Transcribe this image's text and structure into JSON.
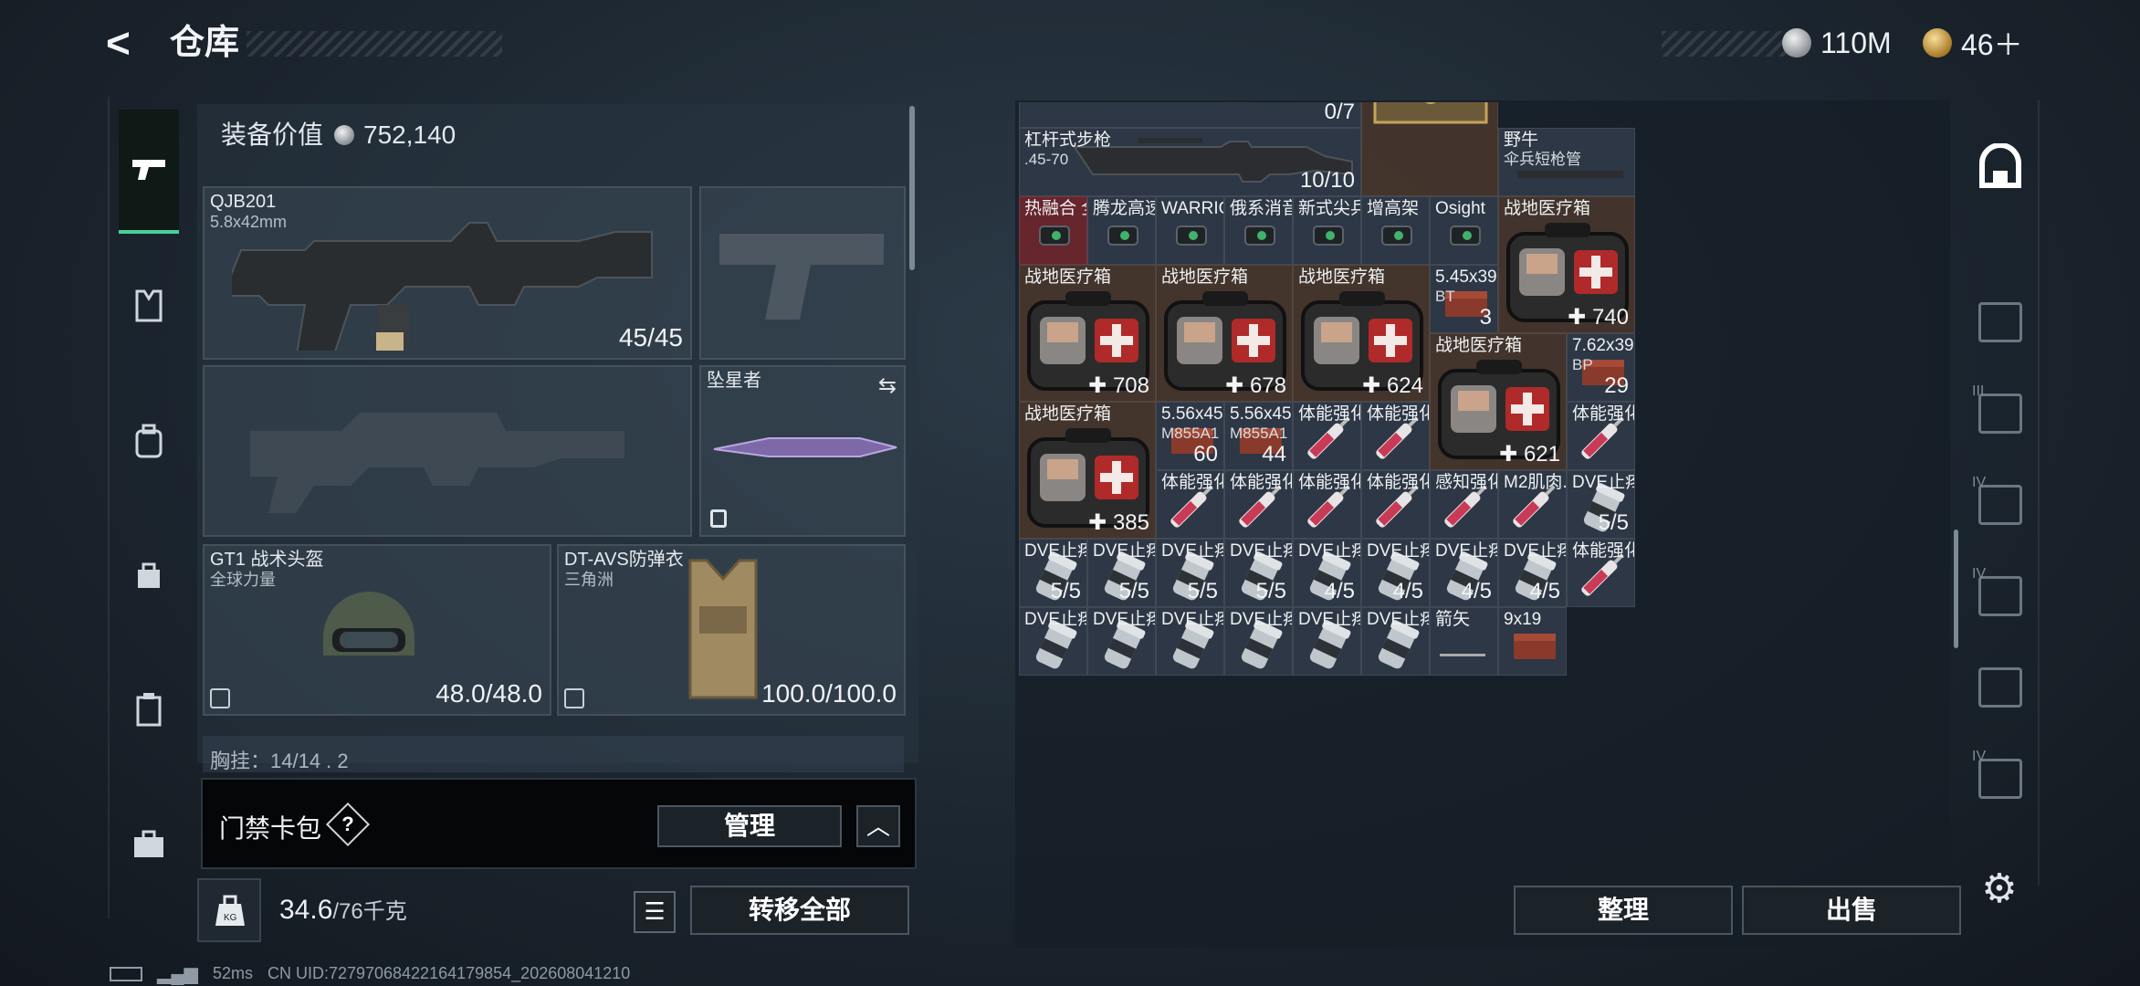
{
  "header": {
    "back_icon": "back-arrow-icon",
    "title": "仓库"
  },
  "currency": {
    "silver": "110M",
    "gold": "46＋"
  },
  "loadout": {
    "value_label": "装备价值",
    "value_amount": "752,140",
    "primary": {
      "name": "QJB201",
      "caliber": "5.8x42mm",
      "ammo": "45/45"
    },
    "secondary": {
      "name": ""
    },
    "melee": {
      "name": "坠星者"
    },
    "helmet": {
      "name": "GT1 战术头盔",
      "sub": "全球力量",
      "durability": "48.0/48.0"
    },
    "armor": {
      "name": "DT-AVS防弹衣",
      "sub": "三角洲",
      "durability": "100.0/100.0"
    },
    "chest_row": "胸挂：14/14 . 2"
  },
  "keycard": {
    "label": "门禁卡包",
    "help": "?",
    "manage": "管理",
    "collapse": "^"
  },
  "capacity": {
    "current": "34.6",
    "max": "/76千克"
  },
  "buttons": {
    "transfer_all": "转移全部",
    "sort": "整理",
    "sell": "出售"
  },
  "status": {
    "ping": "52ms",
    "uid": "CN UID:727970684221641798​54_202608041210"
  },
  "stash_items": [
    {
      "id": "r0c0",
      "name": "",
      "count": "0/7",
      "color": "dark"
    },
    {
      "id": "rifle",
      "name": "杠杆式步枪",
      "sub": ".45-70",
      "count": "10/10",
      "color": "dark",
      "icon": "lever-rifle-icon"
    },
    {
      "id": "case",
      "name": "",
      "count": "",
      "color": "brown",
      "icon": "ammo-case-icon"
    },
    {
      "id": "barrel",
      "name": "野牛",
      "sub": "伞兵短枪管",
      "count": "",
      "color": "dark",
      "icon": "barrel-icon"
    },
    {
      "id": "thermal",
      "name": "热融合 全息",
      "count": "",
      "color": "red",
      "icon": "sight-icon"
    },
    {
      "id": "tenglong",
      "name": "腾龙高速...",
      "count": "",
      "color": "dark",
      "icon": "laser-icon"
    },
    {
      "id": "warrior",
      "name": "WARRIO...",
      "count": "",
      "color": "dark",
      "icon": "flashlight-icon"
    },
    {
      "id": "suppressor",
      "name": "俄系消音",
      "count": "",
      "color": "dark",
      "icon": "suppressor-icon"
    },
    {
      "id": "grip",
      "name": "新式尖兵...",
      "count": "",
      "color": "dark",
      "icon": "grip-icon"
    },
    {
      "id": "riser",
      "name": "增高架",
      "count": "",
      "color": "dark",
      "icon": "riser-icon"
    },
    {
      "id": "osight",
      "name": "Osight",
      "count": "",
      "color": "dark",
      "icon": "red-dot-icon"
    },
    {
      "id": "med1",
      "name": "战地医疗箱",
      "count": "740",
      "color": "brown",
      "icon": "medkit-icon"
    },
    {
      "id": "med2",
      "name": "战地医疗箱",
      "count": "708",
      "color": "brown",
      "icon": "medkit-icon"
    },
    {
      "id": "med3",
      "name": "战地医疗箱",
      "count": "678",
      "color": "brown",
      "icon": "medkit-icon"
    },
    {
      "id": "med4",
      "name": "战地医疗箱",
      "count": "624",
      "color": "brown",
      "icon": "medkit-icon"
    },
    {
      "id": "ammo545",
      "name": "5.45x39",
      "sub": "BT",
      "count": "3",
      "color": "dark",
      "icon": "ammo-box-icon"
    },
    {
      "id": "med5",
      "name": "战地医疗箱",
      "count": "621",
      "color": "brown",
      "icon": "medkit-icon"
    },
    {
      "id": "ammo762",
      "name": "7.62x39",
      "sub": "BP",
      "count": "29",
      "color": "dark",
      "icon": "ammo-box-icon"
    },
    {
      "id": "med6",
      "name": "战地医疗箱",
      "count": "385",
      "color": "brown",
      "icon": "medkit-icon"
    },
    {
      "id": "ammo556a",
      "name": "5.56x45",
      "sub": "M855A1",
      "count": "60",
      "color": "dark",
      "icon": "ammo-box-icon"
    },
    {
      "id": "ammo556b",
      "name": "5.56x45",
      "sub": "M855A1",
      "count": "44",
      "color": "dark",
      "icon": "ammo-box-icon"
    },
    {
      "id": "stim1",
      "name": "体能强化剂",
      "count": "",
      "color": "dark",
      "icon": "syringe-icon"
    },
    {
      "id": "stim2",
      "name": "体能强化剂",
      "count": "",
      "color": "dark",
      "icon": "syringe-icon"
    },
    {
      "id": "stim3",
      "name": "体能强化剂",
      "count": "",
      "color": "dark",
      "icon": "syringe-icon"
    },
    {
      "id": "stim4",
      "name": "体能强化剂",
      "count": "",
      "color": "dark",
      "icon": "syringe-icon"
    },
    {
      "id": "stim5",
      "name": "体能强化剂",
      "count": "",
      "color": "dark",
      "icon": "syringe-icon"
    },
    {
      "id": "stim6",
      "name": "体能强化剂",
      "count": "",
      "color": "dark",
      "icon": "syringe-icon"
    },
    {
      "id": "stim7",
      "name": "体能强化剂",
      "count": "",
      "color": "dark",
      "icon": "syringe-icon"
    },
    {
      "id": "stim8",
      "name": "体能强化剂",
      "count": "",
      "color": "dark",
      "icon": "syringe-icon"
    },
    {
      "id": "percep",
      "name": "感知强化剂",
      "count": "",
      "color": "dark",
      "icon": "syringe-icon"
    },
    {
      "id": "m2",
      "name": "M2肌肉...",
      "count": "",
      "color": "dark",
      "icon": "syringe-icon"
    },
    {
      "id": "dve0",
      "name": "DVE止疼片",
      "count": "5/5",
      "color": "dark",
      "icon": "pill-bottle-icon"
    },
    {
      "id": "dve1",
      "name": "DVE止疼片",
      "count": "5/5",
      "color": "dark",
      "icon": "pill-bottle-icon"
    },
    {
      "id": "dve2",
      "name": "DVE止疼片",
      "count": "5/5",
      "color": "dark",
      "icon": "pill-bottle-icon"
    },
    {
      "id": "dve3",
      "name": "DVE止疼片",
      "count": "5/5",
      "color": "dark",
      "icon": "pill-bottle-icon"
    },
    {
      "id": "dve4",
      "name": "DVE止疼片",
      "count": "5/5",
      "color": "dark",
      "icon": "pill-bottle-icon"
    },
    {
      "id": "dve5",
      "name": "DVE止疼片",
      "count": "4/5",
      "color": "dark",
      "icon": "pill-bottle-icon"
    },
    {
      "id": "dve6",
      "name": "DVE止疼片",
      "count": "4/5",
      "color": "dark",
      "icon": "pill-bottle-icon"
    },
    {
      "id": "dve7",
      "name": "DVE止疼片",
      "count": "4/5",
      "color": "dark",
      "icon": "pill-bottle-icon"
    },
    {
      "id": "dve8",
      "name": "DVE止疼片",
      "count": "4/5",
      "color": "dark",
      "icon": "pill-bottle-icon"
    },
    {
      "id": "dve9",
      "name": "DVE止疼片",
      "count": "",
      "color": "dark",
      "icon": "pill-bottle-icon"
    },
    {
      "id": "dve10",
      "name": "DVE止疼片",
      "count": "",
      "color": "dark",
      "icon": "pill-bottle-icon"
    },
    {
      "id": "dve11",
      "name": "DVE止疼片",
      "count": "",
      "color": "dark",
      "icon": "pill-bottle-icon"
    },
    {
      "id": "dve12",
      "name": "DVE止疼片",
      "count": "",
      "color": "dark",
      "icon": "pill-bottle-icon"
    },
    {
      "id": "dve13",
      "name": "DVE止疼片",
      "count": "",
      "color": "dark",
      "icon": "pill-bottle-icon"
    },
    {
      "id": "dve14",
      "name": "DVE止疼片",
      "count": "",
      "color": "dark",
      "icon": "pill-bottle-icon"
    },
    {
      "id": "arrow",
      "name": "箭矢",
      "count": "",
      "color": "dark",
      "icon": "arrow-icon"
    },
    {
      "id": "ammo9",
      "name": "9x19",
      "count": "",
      "color": "dark",
      "icon": "ammo-box-icon"
    }
  ],
  "right_nav": [
    "backpack-tab-icon",
    "container-2-icon",
    "container-3-icon",
    "container-4-icon",
    "container-5-icon",
    "container-6-icon",
    "container-7-icon"
  ],
  "right_nav_levels": [
    "",
    "",
    "III",
    "IV",
    "IV",
    "",
    "IV"
  ],
  "colors": {
    "accent_green": "#4ad09a",
    "panel": "#283440",
    "cell_brown": "#463629",
    "cell_red": "#6e262e"
  }
}
